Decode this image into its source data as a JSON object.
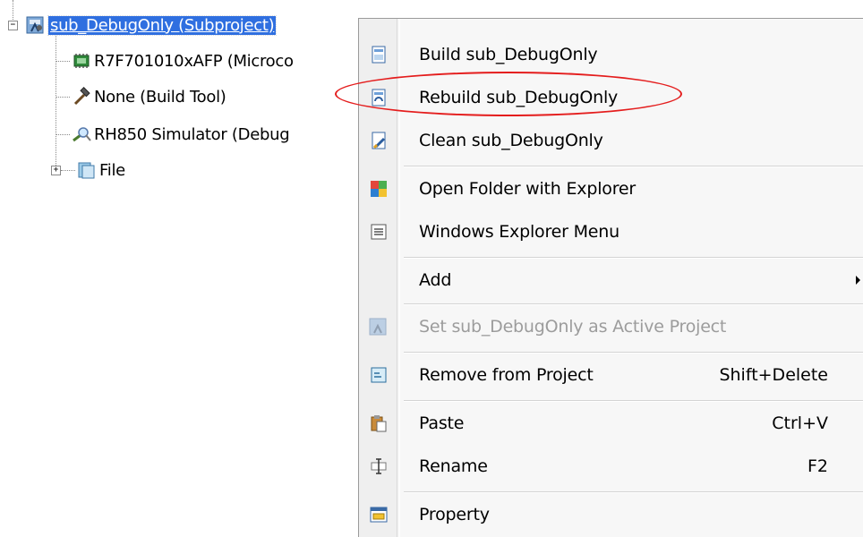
{
  "tree": {
    "root": {
      "label": "sub_DebugOnly (Subproject)",
      "expander": "−",
      "icon": "subproject-icon"
    },
    "children": [
      {
        "label": "R7F701010xAFP (Microco",
        "icon": "microcontroller-icon"
      },
      {
        "label": "None (Build Tool)",
        "icon": "hammer-icon"
      },
      {
        "label": "RH850 Simulator (Debug",
        "icon": "debug-tool-icon"
      },
      {
        "label": "File",
        "icon": "file-folder-icon",
        "expander": "+"
      }
    ]
  },
  "context_menu": {
    "items": [
      {
        "label": "Build sub_DebugOnly",
        "icon": "build-icon",
        "shortcut": "",
        "enabled": true
      },
      {
        "label": "Rebuild sub_DebugOnly",
        "icon": "rebuild-icon",
        "shortcut": "",
        "enabled": true
      },
      {
        "label": "Clean sub_DebugOnly",
        "icon": "clean-icon",
        "shortcut": "",
        "enabled": true
      },
      {
        "label": "Open Folder with Explorer",
        "icon": "open-folder-icon",
        "shortcut": "",
        "enabled": true
      },
      {
        "label": "Windows Explorer Menu",
        "icon": "explorer-menu-icon",
        "shortcut": "",
        "enabled": true
      },
      {
        "label": "Add",
        "icon": "",
        "shortcut": "",
        "enabled": true,
        "submenu": true
      },
      {
        "label": "Set sub_DebugOnly as Active Project",
        "icon": "active-project-icon",
        "shortcut": "",
        "enabled": false
      },
      {
        "label": "Remove from Project",
        "icon": "remove-icon",
        "shortcut": "Shift+Delete",
        "enabled": true
      },
      {
        "label": "Paste",
        "icon": "paste-icon",
        "shortcut": "Ctrl+V",
        "enabled": true
      },
      {
        "label": "Rename",
        "icon": "rename-icon",
        "shortcut": "F2",
        "enabled": true
      },
      {
        "label": "Property",
        "icon": "property-icon",
        "shortcut": "",
        "enabled": true
      }
    ]
  },
  "colors": {
    "selection": "#2f6fe0",
    "highlight_ellipse": "#e41d1d",
    "menu_background": "#f7f7f7",
    "disabled_text": "#9c9c9c"
  }
}
